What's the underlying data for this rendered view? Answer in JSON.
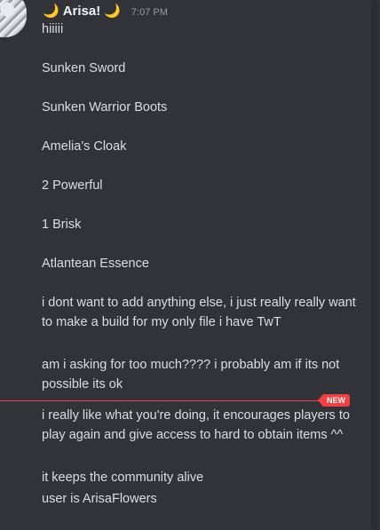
{
  "author": {
    "name": "Arisa!",
    "prefix_emoji": "🌙",
    "suffix_emoji": "🌙",
    "timestamp": "7:07 PM"
  },
  "messages": [
    "hiiiii",
    "Sunken Sword",
    "Sunken Warrior Boots",
    "Amelia's Cloak",
    "2 Powerful",
    "1 Brisk",
    "Atlantean Essence",
    "i dont want to add anything else, i just really really want to make a build for my only file i have TwT",
    "am i asking for too much???? i probably am if its not possible its ok",
    "i really like what you're doing, it encourages players to play again and give access to hard to obtain items ^^",
    "it keeps the community alive",
    "user is ArisaFlowers"
  ],
  "divider": {
    "label": "NEW",
    "color": "#f23f43"
  },
  "colors": {
    "background": "#323339",
    "text": "#dbdee1",
    "username": "#f2f3f5",
    "timestamp": "#949ba4",
    "moon": "#f6c044"
  }
}
